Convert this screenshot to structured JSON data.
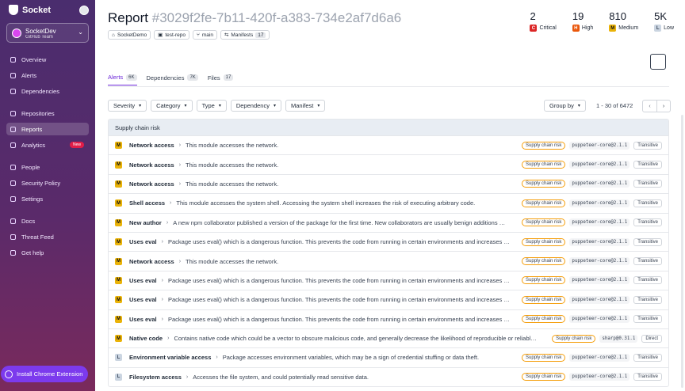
{
  "sidebar": {
    "brand": "Socket",
    "org_name": "SocketDev",
    "org_sub": "GitHub Team",
    "items": [
      {
        "label": "Overview"
      },
      {
        "label": "Alerts"
      },
      {
        "label": "Dependencies"
      },
      {
        "label": "Repositories"
      },
      {
        "label": "Reports",
        "active": true
      },
      {
        "label": "Analytics",
        "badge": "New"
      },
      {
        "label": "People"
      },
      {
        "label": "Security Policy"
      },
      {
        "label": "Settings"
      },
      {
        "label": "Docs"
      },
      {
        "label": "Threat Feed"
      },
      {
        "label": "Get help"
      }
    ],
    "extension_button": "Install Chrome Extension"
  },
  "header": {
    "title": "Report",
    "report_id": "#3029f2fe-7b11-420f-a383-734e2af7d6a6",
    "chips": [
      {
        "label": "SocketDemo"
      },
      {
        "label": "test-repo"
      },
      {
        "label": "main"
      },
      {
        "label": "Manifests",
        "count": "17"
      }
    ]
  },
  "stats": [
    {
      "value": "2",
      "letter": "C",
      "label": "Critical"
    },
    {
      "value": "19",
      "letter": "H",
      "label": "High"
    },
    {
      "value": "810",
      "letter": "M",
      "label": "Medium"
    },
    {
      "value": "5K",
      "letter": "L",
      "label": "Low"
    }
  ],
  "tabs": [
    {
      "label": "Alerts",
      "count": "6K",
      "active": true
    },
    {
      "label": "Dependencies",
      "count": "7K"
    },
    {
      "label": "Files",
      "count": "17"
    }
  ],
  "filters": [
    "Severity",
    "Category",
    "Type",
    "Dependency",
    "Manifest"
  ],
  "group_by": "Group by",
  "pager_text": "1 - 30 of 6472",
  "group_header": "Supply chain risk",
  "rows": [
    {
      "sev": "M",
      "name": "Network access",
      "desc": "This module accesses the network.",
      "risk": "Supply chain risk",
      "pkg": "puppeteer-core@2.1.1",
      "dep": "Transitive"
    },
    {
      "sev": "M",
      "name": "Network access",
      "desc": "This module accesses the network.",
      "risk": "Supply chain risk",
      "pkg": "puppeteer-core@2.1.1",
      "dep": "Transitive"
    },
    {
      "sev": "M",
      "name": "Network access",
      "desc": "This module accesses the network.",
      "risk": "Supply chain risk",
      "pkg": "puppeteer-core@2.1.1",
      "dep": "Transitive"
    },
    {
      "sev": "M",
      "name": "Shell access",
      "desc": "This module accesses the system shell. Accessing the system shell increases the risk of executing arbitrary code.",
      "risk": "Supply chain risk",
      "pkg": "puppeteer-core@2.1.1",
      "dep": "Transitive"
    },
    {
      "sev": "M",
      "name": "New author",
      "desc": "A new npm collaborator published a version of the package for the first time. New collaborators are usually benign additions …",
      "risk": "Supply chain risk",
      "pkg": "puppeteer-core@2.1.1",
      "dep": "Transitive"
    },
    {
      "sev": "M",
      "name": "Uses eval",
      "desc": "Package uses eval() which is a dangerous function. This prevents the code from running in certain environments and increases …",
      "risk": "Supply chain risk",
      "pkg": "puppeteer-core@2.1.1",
      "dep": "Transitive"
    },
    {
      "sev": "M",
      "name": "Network access",
      "desc": "This module accesses the network.",
      "risk": "Supply chain risk",
      "pkg": "puppeteer-core@2.1.1",
      "dep": "Transitive"
    },
    {
      "sev": "M",
      "name": "Uses eval",
      "desc": "Package uses eval() which is a dangerous function. This prevents the code from running in certain environments and increases …",
      "risk": "Supply chain risk",
      "pkg": "puppeteer-core@2.1.1",
      "dep": "Transitive"
    },
    {
      "sev": "M",
      "name": "Uses eval",
      "desc": "Package uses eval() which is a dangerous function. This prevents the code from running in certain environments and increases …",
      "risk": "Supply chain risk",
      "pkg": "puppeteer-core@2.1.1",
      "dep": "Transitive"
    },
    {
      "sev": "M",
      "name": "Uses eval",
      "desc": "Package uses eval() which is a dangerous function. This prevents the code from running in certain environments and increases …",
      "risk": "Supply chain risk",
      "pkg": "puppeteer-core@2.1.1",
      "dep": "Transitive"
    },
    {
      "sev": "M",
      "name": "Native code",
      "desc": "Contains native code which could be a vector to obscure malicious code, and generally decrease the likelihood of reproducible or reliabl…",
      "risk": "Supply chain risk",
      "pkg": "sharp@0.31.1",
      "dep": "Direct"
    },
    {
      "sev": "L",
      "name": "Environment variable access",
      "desc": "Package accesses environment variables, which may be a sign of credential stuffing or data theft.",
      "risk": "Supply chain risk",
      "pkg": "puppeteer-core@2.1.1",
      "dep": "Transitive"
    },
    {
      "sev": "L",
      "name": "Filesystem access",
      "desc": "Accesses the file system, and could potentially read sensitive data.",
      "risk": "Supply chain risk",
      "pkg": "puppeteer-core@2.1.1",
      "dep": "Transitive"
    }
  ]
}
